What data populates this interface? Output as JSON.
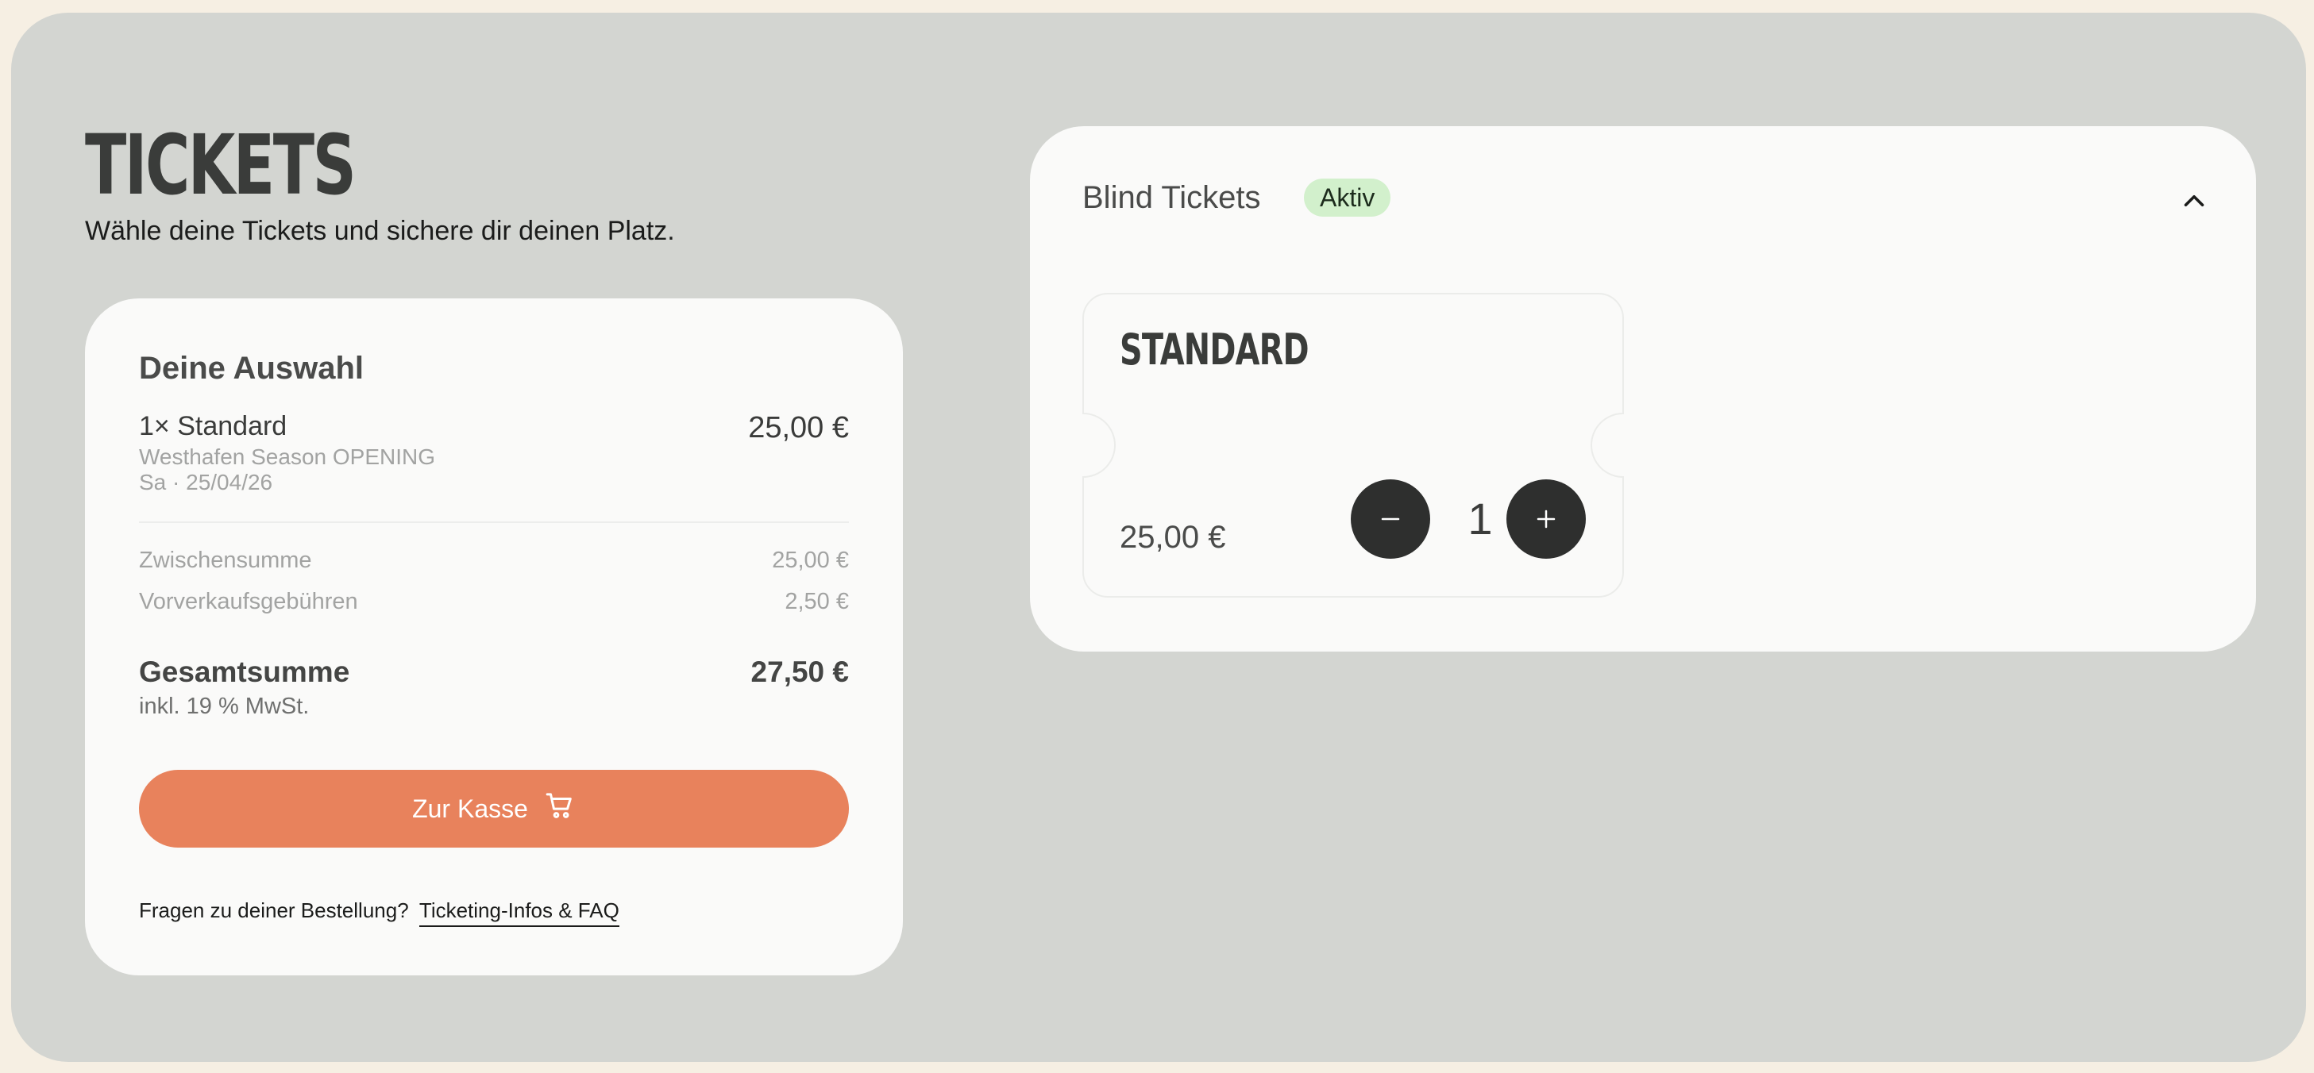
{
  "page": {
    "title": "TICKETS",
    "subtitle": "Wähle deine Tickets und sichere dir deinen Platz."
  },
  "cart": {
    "heading": "Deine Auswahl",
    "item": {
      "name": "1× Standard",
      "event": "Westhafen Season OPENING",
      "date": "Sa · 25/04/26",
      "price": "25,00 €"
    },
    "subtotal_label": "Zwischensumme",
    "subtotal_value": "25,00 €",
    "fees_label": "Vorverkaufsgebühren",
    "fees_value": "2,50 €",
    "total_label": "Gesamtsumme",
    "total_value": "27,50 €",
    "vat_note": "inkl. 19 % MwSt.",
    "checkout_label": "Zur Kasse",
    "faq_text": "Fragen zu deiner Bestellung?",
    "faq_link": "Ticketing-Infos & FAQ"
  },
  "ticket_group": {
    "title": "Blind Tickets",
    "status_badge": "Aktiv",
    "tickets": [
      {
        "name": "STANDARD",
        "price": "25,00 €",
        "quantity": "1"
      }
    ]
  },
  "icons": {
    "checkout": "cart-icon",
    "collapse": "chevron-up-icon",
    "decrement": "minus-icon",
    "increment": "plus-icon"
  },
  "colors": {
    "accent": "#e8825c",
    "badge_bg": "#d2f0cc",
    "stepper_bg": "#2e2f2e",
    "frame_bg": "#d3d5d1",
    "card_bg": "#fafaf9"
  }
}
